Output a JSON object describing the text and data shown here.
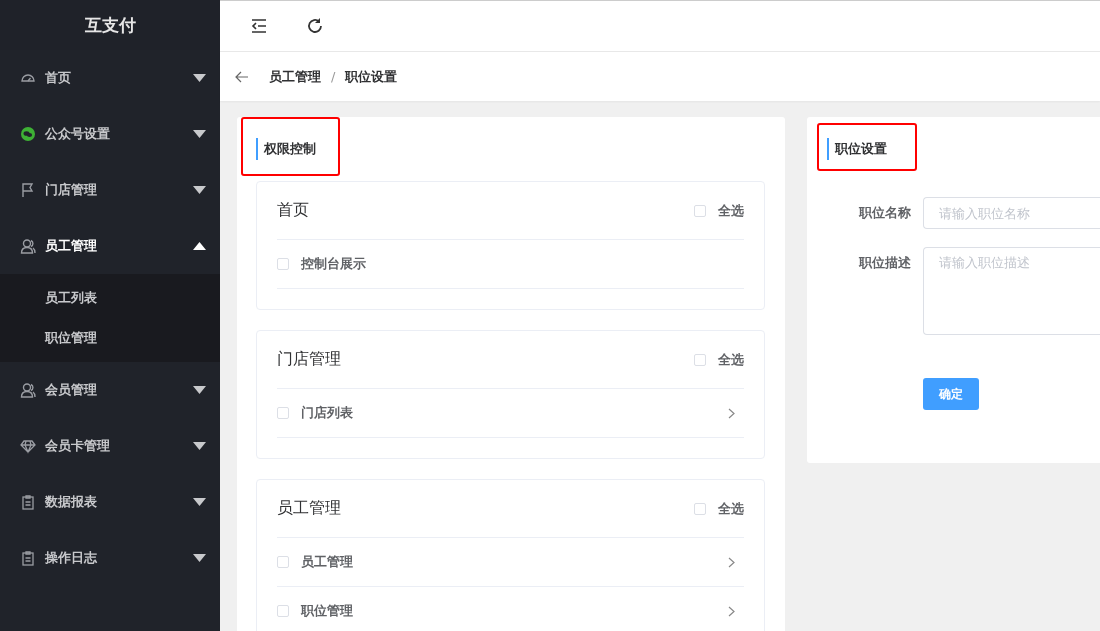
{
  "sidebar": {
    "logo": "互支付",
    "items": [
      {
        "label": "首页",
        "expanded": false
      },
      {
        "label": "公众号设置",
        "expanded": false
      },
      {
        "label": "门店管理",
        "expanded": false
      },
      {
        "label": "员工管理",
        "expanded": true,
        "children": [
          {
            "label": "员工列表"
          },
          {
            "label": "职位管理"
          }
        ]
      },
      {
        "label": "会员管理",
        "expanded": false
      },
      {
        "label": "会员卡管理",
        "expanded": false
      },
      {
        "label": "数据报表",
        "expanded": false
      },
      {
        "label": "操作日志",
        "expanded": false
      }
    ]
  },
  "breadcrumb": {
    "separator": "/",
    "items": [
      "员工管理",
      "职位设置"
    ]
  },
  "permission_panel": {
    "title": "权限控制",
    "highlighted": true,
    "groups": [
      {
        "title": "首页",
        "select_all": {
          "label": "全选",
          "checked": false
        },
        "items": [
          {
            "label": "控制台展示",
            "checked": false,
            "kind": "leaf"
          }
        ]
      },
      {
        "title": "门店管理",
        "select_all": {
          "label": "全选",
          "checked": false
        },
        "items": [
          {
            "label": "门店列表",
            "checked": false,
            "kind": "expandable"
          }
        ]
      },
      {
        "title": "员工管理",
        "select_all": {
          "label": "全选",
          "checked": false
        },
        "items": [
          {
            "label": "员工管理",
            "checked": false,
            "kind": "expandable"
          },
          {
            "label": "职位管理",
            "checked": false,
            "kind": "expandable"
          }
        ]
      }
    ]
  },
  "position_panel": {
    "title": "职位设置",
    "highlighted": true,
    "fields": [
      {
        "label": "职位名称",
        "placeholder": "请输入职位名称",
        "kind": "input"
      },
      {
        "label": "职位描述",
        "placeholder": "请输入职位描述",
        "kind": "textarea"
      }
    ],
    "submit": "确定"
  }
}
